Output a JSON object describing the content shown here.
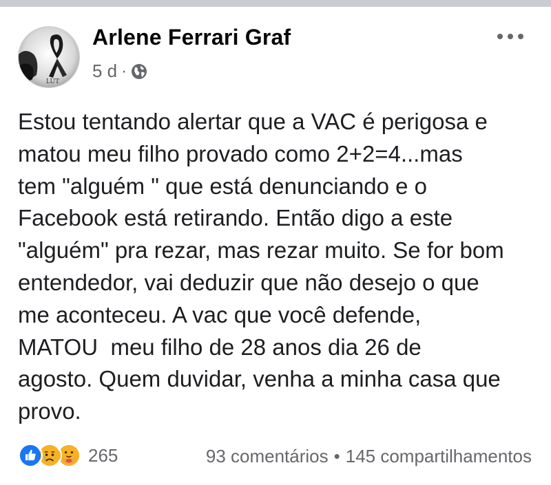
{
  "post": {
    "author": "Arlene Ferrari Graf",
    "time": "5 d",
    "separator": "·",
    "privacy_icon": "globe-icon",
    "more_icon": "more-options-icon",
    "avatar_text": "LUT",
    "text": "Estou tentando alertar que a VAC é perigosa e\nmatou meu filho provado como 2+2=4...mas\ntem \"alguém \" que está denunciando e o\nFacebook está retirando. Então digo a este\n\"alguém\" pra rezar, mas rezar muito. Se for bom\nentendedor, vai deduzir que não desejo o que\nme aconteceu. A vac que você defende,\nMATOU  meu filho de 28 anos dia 26 de\nagosto. Quem duvidar, venha a minha casa que\nprovo."
  },
  "footer": {
    "reaction_icons": [
      "like-icon",
      "sad-icon",
      "care-icon"
    ],
    "reaction_count": "265",
    "comments": "93 comentários",
    "stats_separator": "•",
    "shares": "145 compartilhamentos"
  },
  "colors": {
    "like_blue": "#1877f2",
    "emoji_yellow": "#f7b125",
    "meta_gray": "#65676b",
    "text_dark": "#1c1e21"
  }
}
